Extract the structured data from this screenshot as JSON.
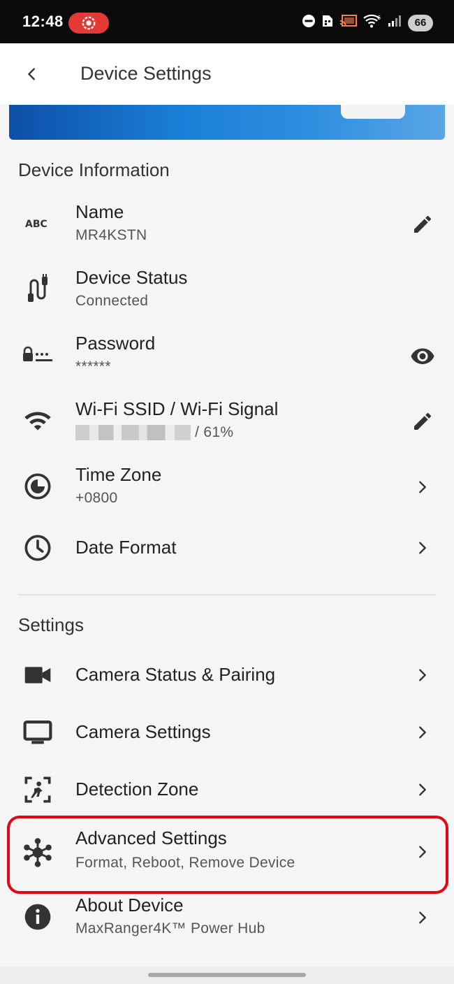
{
  "status_bar": {
    "time": "12:48",
    "battery": "66",
    "icons": [
      "screen-record-icon",
      "do-not-disturb-icon",
      "sim-icon",
      "cast-icon",
      "wifi-icon",
      "signal-icon"
    ]
  },
  "header": {
    "title": "Device Settings",
    "back_icon": "arrow-left-icon"
  },
  "device_information": {
    "section_title": "Device Information",
    "name": {
      "title": "Name",
      "value": "MR4KSTN",
      "icon": "abc-icon",
      "action_icon": "pencil-icon"
    },
    "status": {
      "title": "Device Status",
      "value": "Connected",
      "icon": "cable-plug-icon"
    },
    "password": {
      "title": "Password",
      "value": "******",
      "icon": "password-lock-icon",
      "action_icon": "eye-icon"
    },
    "wifi": {
      "title": "Wi-Fi SSID / Wi-Fi Signal",
      "signal": "/ 61%",
      "icon": "wifi-icon",
      "action_icon": "pencil-icon"
    },
    "timezone": {
      "title": "Time Zone",
      "value": "+0800",
      "icon": "timezone-icon"
    },
    "date_format": {
      "title": "Date Format",
      "icon": "clock-icon"
    }
  },
  "settings": {
    "section_title": "Settings",
    "items": [
      {
        "title": "Camera Status & Pairing",
        "icon": "video-camera-icon"
      },
      {
        "title": "Camera Settings",
        "icon": "monitor-icon"
      },
      {
        "title": "Detection Zone",
        "icon": "detection-person-icon"
      },
      {
        "title": "Advanced Settings",
        "subtitle": "Format, Reboot, Remove Device",
        "icon": "hub-nodes-icon",
        "highlighted": true
      },
      {
        "title": "About Device",
        "subtitle": "MaxRanger4K™ Power Hub",
        "icon": "info-icon"
      }
    ]
  },
  "colors": {
    "highlight": "#e30613",
    "banner": "#1a7fd8",
    "text": "#212121",
    "secondary_text": "#555555"
  }
}
